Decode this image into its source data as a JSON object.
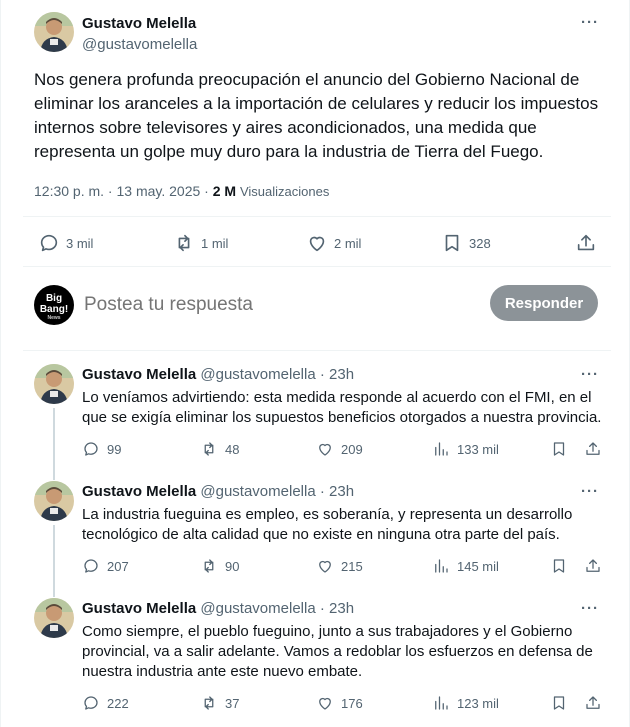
{
  "main_tweet": {
    "author_name": "Gustavo Melella",
    "author_handle": "@gustavomelella",
    "more_label": "···",
    "text": "Nos genera profunda preocupación el anuncio del Gobierno Nacional de eliminar los aranceles a la importación de celulares y reducir los impuestos internos sobre televisores y aires acondicionados, una medida que representa un golpe muy duro para la industria de Tierra del Fuego.",
    "timestamp": "12:30 p. m. · 13 may. 2025 · ",
    "views_count": "2 M",
    "views_label": "Visualizaciones",
    "stats": {
      "replies": "3 mil",
      "reposts": "1 mil",
      "likes": "2 mil",
      "bookmarks": "328"
    }
  },
  "reply_composer": {
    "logo_line1": "Big",
    "logo_line2": "Bang!",
    "logo_line3": "News",
    "placeholder": "Postea tu respuesta",
    "button_label": "Responder"
  },
  "replies": [
    {
      "author_name": "Gustavo Melella",
      "author_handle": "@gustavomelella · 23h",
      "text": "Lo veníamos advirtiendo: esta medida responde al acuerdo con el FMI, en el que se exigía eliminar los supuestos beneficios otorgados a nuestra provincia.",
      "replies": "99",
      "reposts": "48",
      "likes": "209",
      "views": "133 mil"
    },
    {
      "author_name": "Gustavo Melella",
      "author_handle": "@gustavomelella · 23h",
      "text": "La industria fueguina es empleo, es soberanía, y representa un desarrollo tecnológico de alta calidad que no existe en ninguna otra parte del país.",
      "replies": "207",
      "reposts": "90",
      "likes": "215",
      "views": "145 mil"
    },
    {
      "author_name": "Gustavo Melella",
      "author_handle": "@gustavomelella · 23h",
      "text": "Como siempre, el pueblo fueguino, junto a sus trabajadores y el Gobierno provincial, va a salir adelante. Vamos a redoblar los esfuerzos en defensa de nuestra industria ante este nuevo embate.",
      "replies": "222",
      "reposts": "37",
      "likes": "176",
      "views": "123 mil"
    }
  ],
  "colors": {
    "text": "#0f1419",
    "secondary": "#536471",
    "button_disabled": "#8c9398",
    "divider": "#eff3f4"
  }
}
